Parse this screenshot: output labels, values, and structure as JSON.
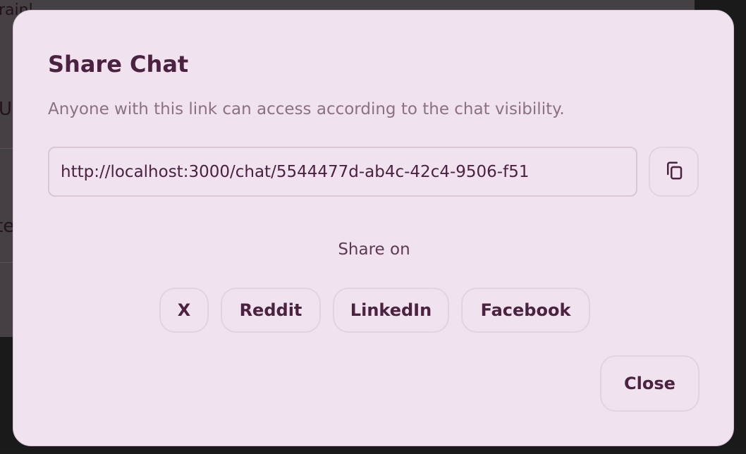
{
  "dialog": {
    "title": "Share Chat",
    "description": "Anyone with this link can access according to the chat visibility.",
    "link_value": "http://localhost:3000/chat/5544477d-ab4c-42c4-9506-f51",
    "copy_icon": "copy-icon",
    "share_on_label": "Share on",
    "share_buttons": [
      {
        "label": "X"
      },
      {
        "label": "Reddit"
      },
      {
        "label": "LinkedIn"
      },
      {
        "label": "Facebook"
      }
    ],
    "close_label": "Close"
  },
  "background": {
    "fragments": [
      "rainl",
      "U",
      "te"
    ]
  },
  "colors": {
    "dialog_bg": "#f0e2ef",
    "title_text": "#4b2340",
    "muted_text": "#8a7283",
    "border": "#d9c7d6"
  }
}
